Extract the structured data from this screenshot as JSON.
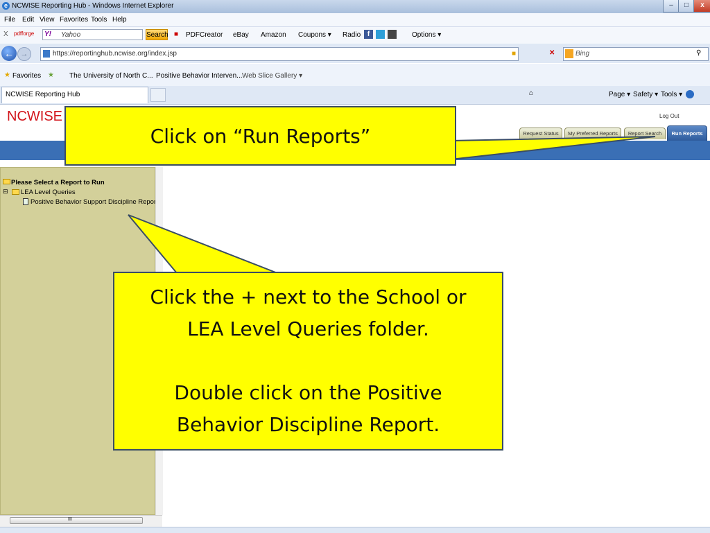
{
  "window": {
    "title": "NCWISE Reporting Hub - Windows Internet Explorer",
    "controls": {
      "minimize": "–",
      "maximize": "□",
      "close": "x"
    }
  },
  "menubar": [
    "File",
    "Edit",
    "View",
    "Favorites",
    "Tools",
    "Help"
  ],
  "yahoo_toolbar": {
    "close": "X",
    "pdfforge": "pdfforge",
    "yahoo_logo": "Y!",
    "search_value": "Yahoo",
    "search_button": "Search",
    "items": [
      "PDFCreator",
      "eBay",
      "Amazon",
      "Coupons ▾",
      "Radio",
      "Options ▾"
    ]
  },
  "address_bar": {
    "url": "https://reportinghub.ncwise.org/index.jsp",
    "search_placeholder": "Bing"
  },
  "favorites_bar": {
    "favorites_label": "Favorites",
    "links": [
      "The University of North C...",
      "Positive Behavior Interven...",
      "Web Slice Gallery ▾"
    ]
  },
  "tabs": {
    "active_tab": "NCWISE Reporting Hub"
  },
  "command_bar": {
    "items": [
      "Page ▾",
      "Safety ▾",
      "Tools ▾"
    ]
  },
  "app": {
    "logo_nc": "NCWISE",
    "logout": "Log Out",
    "nav_tabs": [
      "Request Status",
      "My Preferred Reports",
      "Report Search",
      "Run Reports"
    ],
    "tree": {
      "root": "Please Select a Report to Run",
      "folder": "LEA Level Queries",
      "report": "Positive Behavior Support Discipline Report"
    },
    "hscroll_label": "III"
  },
  "callouts": {
    "top": "Click on “Run Reports”",
    "bottom_line1": "Click the + next to the School or",
    "bottom_line2": "LEA Level Queries folder.",
    "bottom_line3": "Double click on the Positive",
    "bottom_line4": "Behavior Discipline Report."
  },
  "colors": {
    "callout_fill": "#ffff00",
    "blue_band": "#3a6fb5",
    "tree_panel": "#d3d09a",
    "logo_red": "#d2131a"
  }
}
